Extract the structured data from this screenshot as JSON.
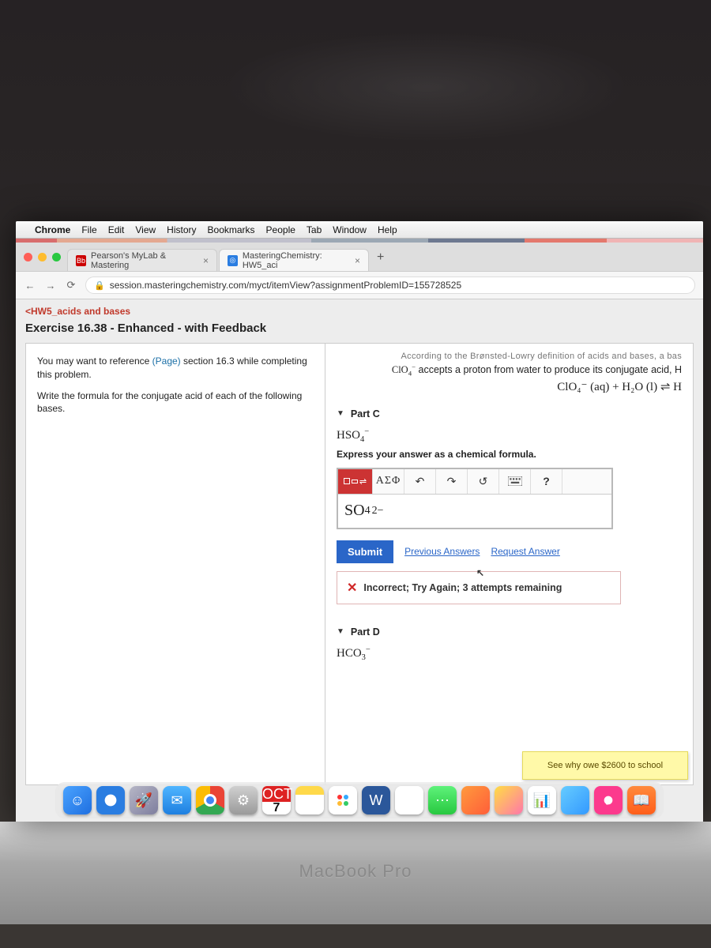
{
  "menubar": {
    "app": "Chrome",
    "items": [
      "File",
      "Edit",
      "View",
      "History",
      "Bookmarks",
      "People",
      "Tab",
      "Window",
      "Help"
    ]
  },
  "tabs": [
    {
      "label": "Pearson's MyLab & Mastering",
      "active": false
    },
    {
      "label": "MasteringChemistry: HW5_aci",
      "active": true
    }
  ],
  "address": "session.masteringchemistry.com/myct/itemView?assignmentProblemID=155728525",
  "crumb": "<HW5_acids and bases",
  "exercise_title": "Exercise 16.38 - Enhanced - with Feedback",
  "left": {
    "p1a": "You may want to reference ",
    "p1link": "(Page)",
    "p1b": " section 16.3 while completing this problem.",
    "p2": "Write the formula for the conjugate acid of each of the following bases."
  },
  "right": {
    "scribble": "According to the Brønsted-Lowry definition of acids and bases, a bas",
    "preamble_a": "ClO",
    "preamble_b": " accepts a proton from water to produce its conjugate acid, H",
    "eqn": "ClO₄⁻ (aq) + H₂O (l) ⇌ H",
    "partC": {
      "title": "Part C",
      "species_base": "HSO",
      "species_sub": "4",
      "species_charge": "−",
      "instruction": "Express your answer as a chemical formula.",
      "toolbar": {
        "greek": "ΑΣΦ",
        "help": "?"
      },
      "answer_base": "SO",
      "answer_sub": "4",
      "answer_sup": "2−",
      "submit": "Submit",
      "prev": "Previous Answers",
      "req": "Request Answer",
      "feedback": "Incorrect; Try Again; 3 attempts remaining"
    },
    "partD": {
      "title": "Part D",
      "species_base": "HCO",
      "species_sub": "3",
      "species_charge": "−"
    }
  },
  "sticky": "See why owe $2600 to school",
  "calendar": {
    "month": "OCT",
    "day": "7"
  },
  "laptop_label": "MacBook Pro"
}
